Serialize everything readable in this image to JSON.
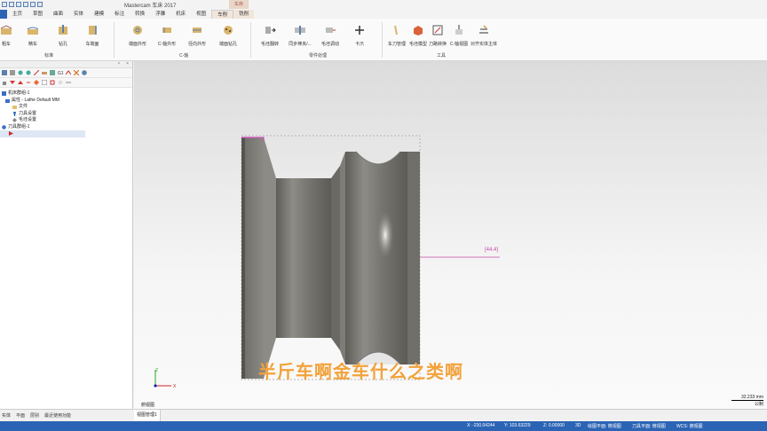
{
  "app": {
    "title": "Mastercam 车床 2017",
    "context_tab_group": "车床"
  },
  "tabs": [
    {
      "label": "",
      "id": "file"
    },
    {
      "label": "主页"
    },
    {
      "label": "草图"
    },
    {
      "label": "曲面"
    },
    {
      "label": "实体"
    },
    {
      "label": "建模"
    },
    {
      "label": "标注"
    },
    {
      "label": "转换"
    },
    {
      "label": "浮雕"
    },
    {
      "label": "机床"
    },
    {
      "label": "视图"
    },
    {
      "label": "车削"
    },
    {
      "label": "铣削"
    }
  ],
  "ribbon": {
    "buttons": [
      {
        "label": "粗车"
      },
      {
        "label": "精车"
      },
      {
        "label": "钻孔"
      },
      {
        "label": "车端面"
      },
      {
        "label": "端面外形"
      },
      {
        "label": "C-轴外形"
      },
      {
        "label": "径向外形"
      },
      {
        "label": "端面钻孔"
      },
      {
        "label": "毛坯翻转"
      },
      {
        "label": "同步棒夹/..."
      },
      {
        "label": "毛坯调动"
      },
      {
        "label": "卡爪"
      },
      {
        "label": "车刀管理"
      },
      {
        "label": "毛坯模型"
      },
      {
        "label": "刀路转换"
      },
      {
        "label": "C-轴视图"
      },
      {
        "label": "对齐实体主体"
      }
    ],
    "groups": [
      {
        "label": "标准"
      },
      {
        "label": "C-轴"
      },
      {
        "label": "零件处理"
      },
      {
        "label": "工具"
      }
    ]
  },
  "panel": {
    "pin": "ᵖ",
    "close": "×",
    "tree": [
      {
        "label": "机床群组-1"
      },
      {
        "label": "属性 - Lathe Default MM"
      },
      {
        "label": "文件"
      },
      {
        "label": "刀具设置"
      },
      {
        "label": "毛坯设置"
      },
      {
        "label": "刀具群组-1"
      },
      {
        "label": ""
      }
    ]
  },
  "viewport": {
    "subtitle": "半斤车啊金车什么之类啊",
    "dimension": "[44.4]",
    "view_name": "俯视图",
    "scale_value": "32.233 mm",
    "scale_unit": "公制",
    "axis_x": "X",
    "axis_z": "Z",
    "tab": "视图管理1"
  },
  "bottom_tabs": [
    "实体",
    "平面",
    "层别",
    "最近使用功能"
  ],
  "status": {
    "x": "X:   -230.04244",
    "y": "Y:   103.63229",
    "z": "Z:   0.00000",
    "mode": "3D",
    "plane1": "绘图平面: 俯视图",
    "plane2": "刀具平面: 俯视图",
    "wcs": "WCS: 俯视图"
  },
  "colors": {
    "accent": "#2b64b5",
    "subtitle": "#f2a23a",
    "dimension": "#c64aa9",
    "part": "#7c7b76"
  }
}
